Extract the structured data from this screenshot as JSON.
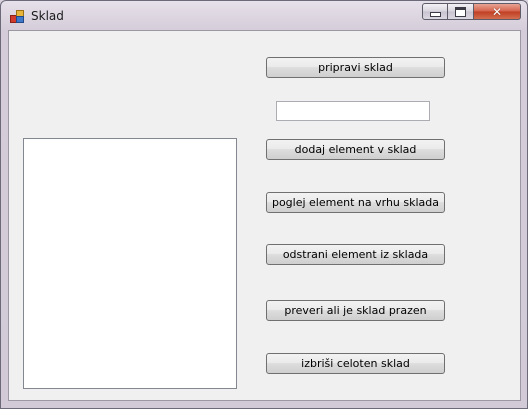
{
  "window": {
    "title": "Sklad"
  },
  "input": {
    "value": "",
    "placeholder": ""
  },
  "buttons": {
    "pripravi": "pripravi sklad",
    "dodaj": "dodaj element v sklad",
    "poglej": "poglej element na vrhu sklada",
    "odstrani": "odstrani element iz sklada",
    "preveri": "preveri ali je sklad prazen",
    "izbrisi": "izbriši celoten sklad"
  },
  "listbox": {
    "items": []
  }
}
